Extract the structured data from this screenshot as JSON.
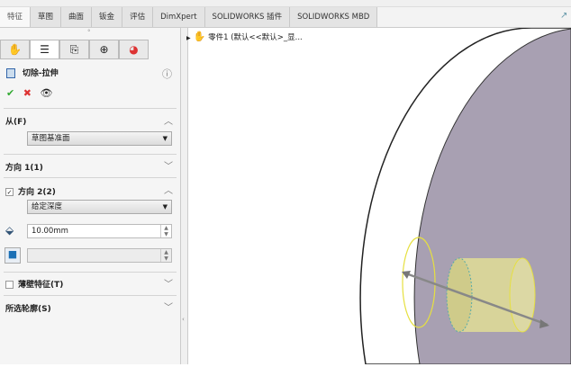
{
  "tabs": [
    "特征",
    "草图",
    "曲面",
    "钣金",
    "评估",
    "DimXpert",
    "SOLIDWORKS 插件",
    "SOLIDWORKS MBD"
  ],
  "active_tab": 0,
  "tree": {
    "item": "零件1 (默认<<默认>_显..."
  },
  "panel": {
    "title": "切除-拉伸",
    "from": {
      "label": "从(F)",
      "value": "草图基准面"
    },
    "dir1": {
      "label": "方向 1(1)"
    },
    "dir2": {
      "label": "方向 2(2)",
      "checked": true,
      "end_condition": "给定深度",
      "depth": "10.00mm"
    },
    "thin": {
      "label": "薄壁特征(T)",
      "checked": false
    },
    "contours": {
      "label": "所选轮廓(S)"
    }
  },
  "colors": {
    "face": "#a8a0b2",
    "cylinder": "#d8d49a"
  }
}
